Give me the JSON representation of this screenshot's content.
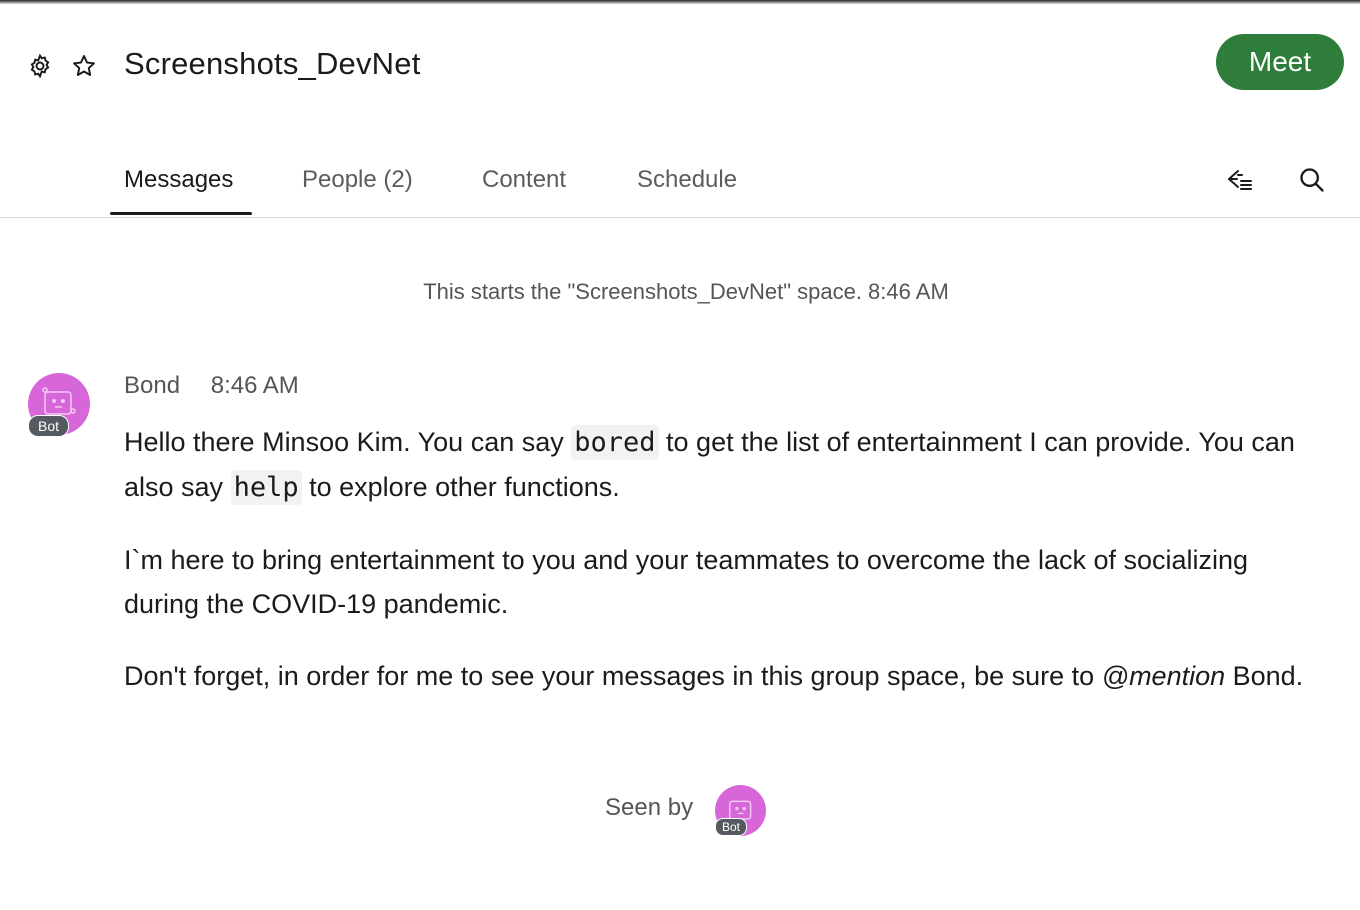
{
  "header": {
    "title": "Screenshots_DevNet",
    "meet_label": "Meet"
  },
  "tabs": [
    {
      "label": "Messages"
    },
    {
      "label": "People (2)"
    },
    {
      "label": "Content"
    },
    {
      "label": "Schedule"
    }
  ],
  "conversation": {
    "space_start": "This starts the \"Screenshots_DevNet\" space. 8:46 AM",
    "message": {
      "sender": "Bond",
      "time": "8:46 AM",
      "avatar_badge": "Bot",
      "p1_a": "Hello there Minsoo Kim. You can say ",
      "p1_code1": "bored",
      "p1_b": " to get the list of entertainment I can provide. You can also say ",
      "p1_code2": "help",
      "p1_c": " to explore other functions.",
      "p2": "I`m here to bring entertainment to you and your teammates to overcome the lack of socializing during the COVID-19 pandemic.",
      "p3_a": "Don't forget, in order for me to see your messages in this group space, be sure to ",
      "p3_em": "@mention",
      "p3_b": " Bond."
    },
    "seen_by_label": "Seen by",
    "seen_avatar_badge": "Bot"
  },
  "colors": {
    "meet_button": "#2f7d3a",
    "avatar": "#d767d9"
  }
}
